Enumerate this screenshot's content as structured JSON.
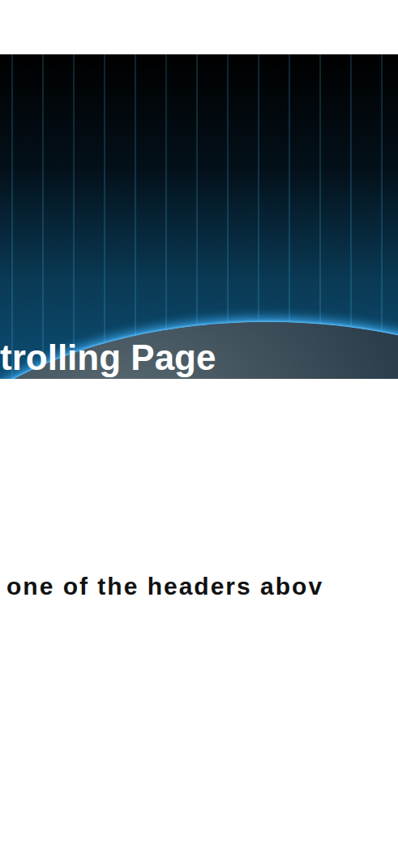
{
  "banner": {
    "title": "trolling Page"
  },
  "message": "one of the headers abov"
}
